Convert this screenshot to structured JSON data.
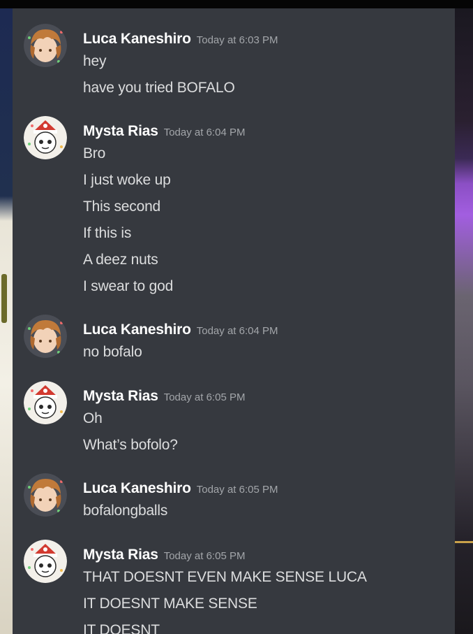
{
  "messages": [
    {
      "author": "Luca Kaneshiro",
      "timestamp": "Today at 6:03 PM",
      "avatar_icon": "luca-avatar",
      "lines": [
        "hey",
        "have you tried BOFALO"
      ]
    },
    {
      "author": "Mysta Rias",
      "timestamp": "Today at 6:04 PM",
      "avatar_icon": "mysta-avatar",
      "lines": [
        "Bro",
        "I just woke up",
        "This second",
        "If this is",
        "A deez nuts",
        "I swear to god"
      ]
    },
    {
      "author": "Luca Kaneshiro",
      "timestamp": "Today at 6:04 PM",
      "avatar_icon": "luca-avatar",
      "lines": [
        "no bofalo"
      ]
    },
    {
      "author": "Mysta Rias",
      "timestamp": "Today at 6:05 PM",
      "avatar_icon": "mysta-avatar",
      "lines": [
        "Oh",
        "What’s bofolo?"
      ]
    },
    {
      "author": "Luca Kaneshiro",
      "timestamp": "Today at 6:05 PM",
      "avatar_icon": "luca-avatar",
      "lines": [
        "bofalongballs"
      ]
    },
    {
      "author": "Mysta Rias",
      "timestamp": "Today at 6:05 PM",
      "avatar_icon": "mysta-avatar",
      "lines": [
        "THAT DOESNT EVEN MAKE SENSE LUCA",
        "IT DOESNT MAKE SENSE",
        "IT DOESNT"
      ]
    }
  ],
  "colors": {
    "panel_background": "#36393f",
    "author_text": "#ffffff",
    "message_text": "#dcddde",
    "timestamp_text": "#a3a6aa"
  }
}
